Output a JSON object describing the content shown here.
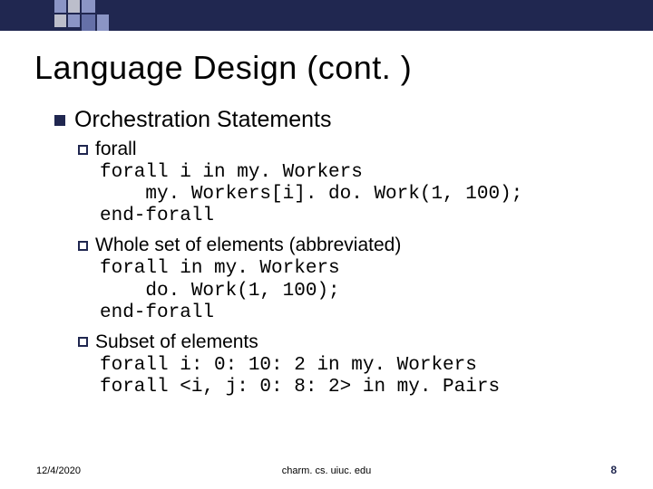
{
  "title": "Language Design (cont. )",
  "level1": {
    "label": "Orchestration Statements"
  },
  "sub1": {
    "label": "forall"
  },
  "code1": "forall i in my. Workers\n    my. Workers[i]. do. Work(1, 100);\nend-forall",
  "sub2": {
    "label": "Whole set of elements (abbreviated)"
  },
  "code2": "forall in my. Workers\n    do. Work(1, 100);\nend-forall",
  "sub3": {
    "label": "Subset of elements"
  },
  "code3": "forall i: 0: 10: 2 in my. Workers\nforall <i, j: 0: 8: 2> in my. Pairs",
  "footer": {
    "date": "12/4/2020",
    "center": "charm. cs. uiuc. edu",
    "page": "8"
  }
}
